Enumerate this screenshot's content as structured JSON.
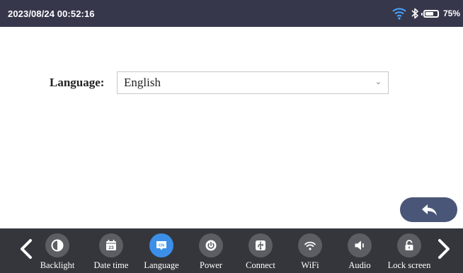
{
  "status_bar": {
    "datetime": "2023/08/24 00:52:16",
    "battery_percent_label": "75%",
    "battery_level": 0.75,
    "icons": [
      "wifi-icon",
      "bluetooth-icon",
      "battery-icon"
    ]
  },
  "settings": {
    "language_label": "Language:",
    "language_value": "English"
  },
  "back_button": {
    "icon": "back-arrow-icon"
  },
  "dock": {
    "items": [
      {
        "label": "Backlight",
        "icon": "contrast-icon"
      },
      {
        "label": "Date time",
        "icon": "calendar-icon",
        "icon_text": "23"
      },
      {
        "label": "Language",
        "icon": "language-icon",
        "icon_text": "CN",
        "active": true
      },
      {
        "label": "Power",
        "icon": "power-icon"
      },
      {
        "label": "Connect",
        "icon": "usb-icon"
      },
      {
        "label": "WiFi",
        "icon": "wifi-icon"
      },
      {
        "label": "Audio",
        "icon": "speaker-icon"
      },
      {
        "label": "Lock screen",
        "icon": "lock-icon"
      }
    ]
  },
  "colors": {
    "status_bar_bg": "#36374b",
    "dock_bg": "#35363b",
    "active_accent": "#3b8fe8",
    "back_button_bg": "#4a5677"
  }
}
